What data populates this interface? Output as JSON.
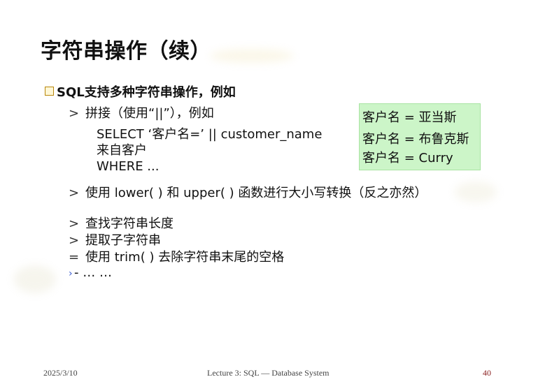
{
  "title": "字符串操作（续）",
  "bullet": "SQL支持多种字符串操作，例如",
  "items": [
    {
      "mark": ">",
      "text": "拼接（使用“||”），例如"
    },
    {
      "mark": ">",
      "text": "使用 lower( ) 和 upper( ) 函数进行大小写转换（反之亦然）"
    },
    {
      "mark": ">",
      "text": "查找字符串长度"
    },
    {
      "mark": ">",
      "text": "提取子字符串"
    },
    {
      "mark": "=",
      "text": "使用 trim( ) 去除字符串末尾的空格"
    },
    {
      "mark": "›",
      "text": "- … …"
    }
  ],
  "code": {
    "line1": "SELECT ‘客户名=’ || customer_name",
    "line2": "来自客户",
    "line3": "WHERE ..."
  },
  "result_box": [
    "客户名 = 亚当斯",
    "客户名 = 布鲁克斯",
    "客户名 = Curry"
  ],
  "footer": {
    "date": "2025/3/10",
    "course": "Lecture 3: SQL — Database System",
    "page": "40"
  },
  "colors": {
    "result_box_bg": "#ccf5c8",
    "bullet_box": "#b8860b"
  }
}
